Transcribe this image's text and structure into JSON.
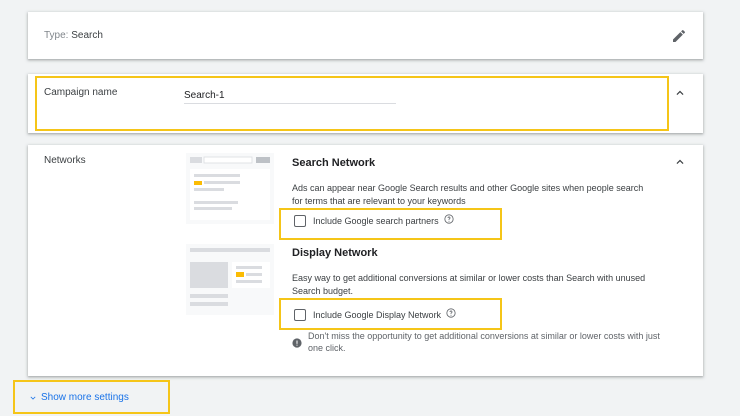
{
  "type_card": {
    "label": "Type:",
    "value": "Search"
  },
  "campaign_name": {
    "label": "Campaign name",
    "value": "Search-1"
  },
  "networks": {
    "label": "Networks",
    "search_network": {
      "title": "Search Network",
      "description": "Ads can appear near Google Search results and other Google sites when people search for terms that are relevant to your keywords",
      "checkbox_label": "Include Google search partners",
      "checked": false
    },
    "display_network": {
      "title": "Display Network",
      "description": "Easy way to get additional conversions at similar or lower costs than Search with unused Search budget.",
      "checkbox_label": "Include Google Display Network",
      "checked": false,
      "info": "Don't miss the opportunity to get additional conversions at similar or lower costs with just one click."
    }
  },
  "show_more": {
    "label": "Show more settings"
  },
  "colors": {
    "highlight": "#f5c518",
    "link": "#1a73e8",
    "background": "#f1f3f4"
  },
  "icons": [
    "edit-icon",
    "chevron-up-icon",
    "help-icon",
    "info-icon",
    "chevron-down-icon"
  ]
}
